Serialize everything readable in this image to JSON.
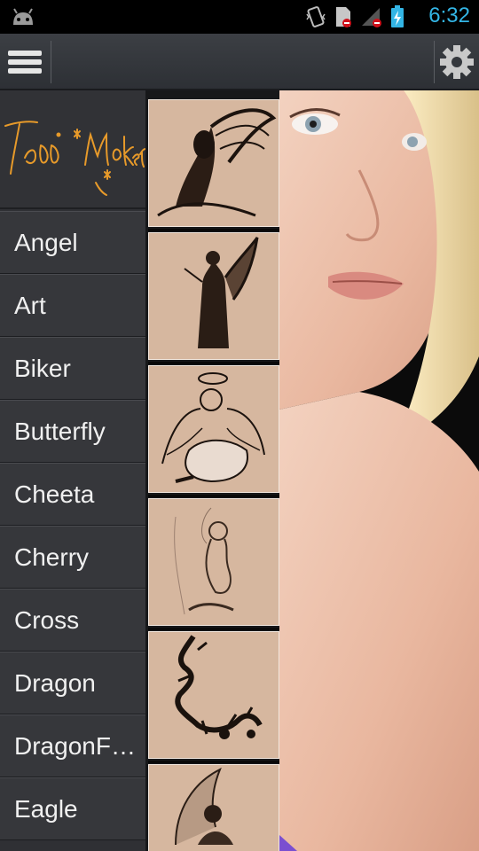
{
  "status_bar": {
    "time": "6:32"
  },
  "app": {
    "logo_text": "Tattoo Maker"
  },
  "icons": {
    "menu": "hamburger-menu-icon",
    "settings": "gear-icon",
    "android": "android-icon",
    "vibrate": "vibrate-icon",
    "sd": "sd-card-icon",
    "signal": "signal-icon",
    "battery": "battery-charging-icon"
  },
  "colors": {
    "accent": "#33b5e5",
    "logo": "#e79a2a",
    "thumb_bg": "#d6b79f",
    "drawer": "#36373b"
  },
  "categories": [
    {
      "label": "Angel"
    },
    {
      "label": "Art"
    },
    {
      "label": "Biker"
    },
    {
      "label": "Butterfly"
    },
    {
      "label": "Cheeta"
    },
    {
      "label": "Cherry"
    },
    {
      "label": "Cross"
    },
    {
      "label": "Dragon"
    },
    {
      "label": "DragonF…"
    },
    {
      "label": "Eagle"
    }
  ],
  "thumbnails": [
    {
      "name": "thumb-angel-1"
    },
    {
      "name": "thumb-angel-2"
    },
    {
      "name": "thumb-angel-3"
    },
    {
      "name": "thumb-angel-4"
    },
    {
      "name": "thumb-angel-5"
    },
    {
      "name": "thumb-angel-6"
    }
  ]
}
